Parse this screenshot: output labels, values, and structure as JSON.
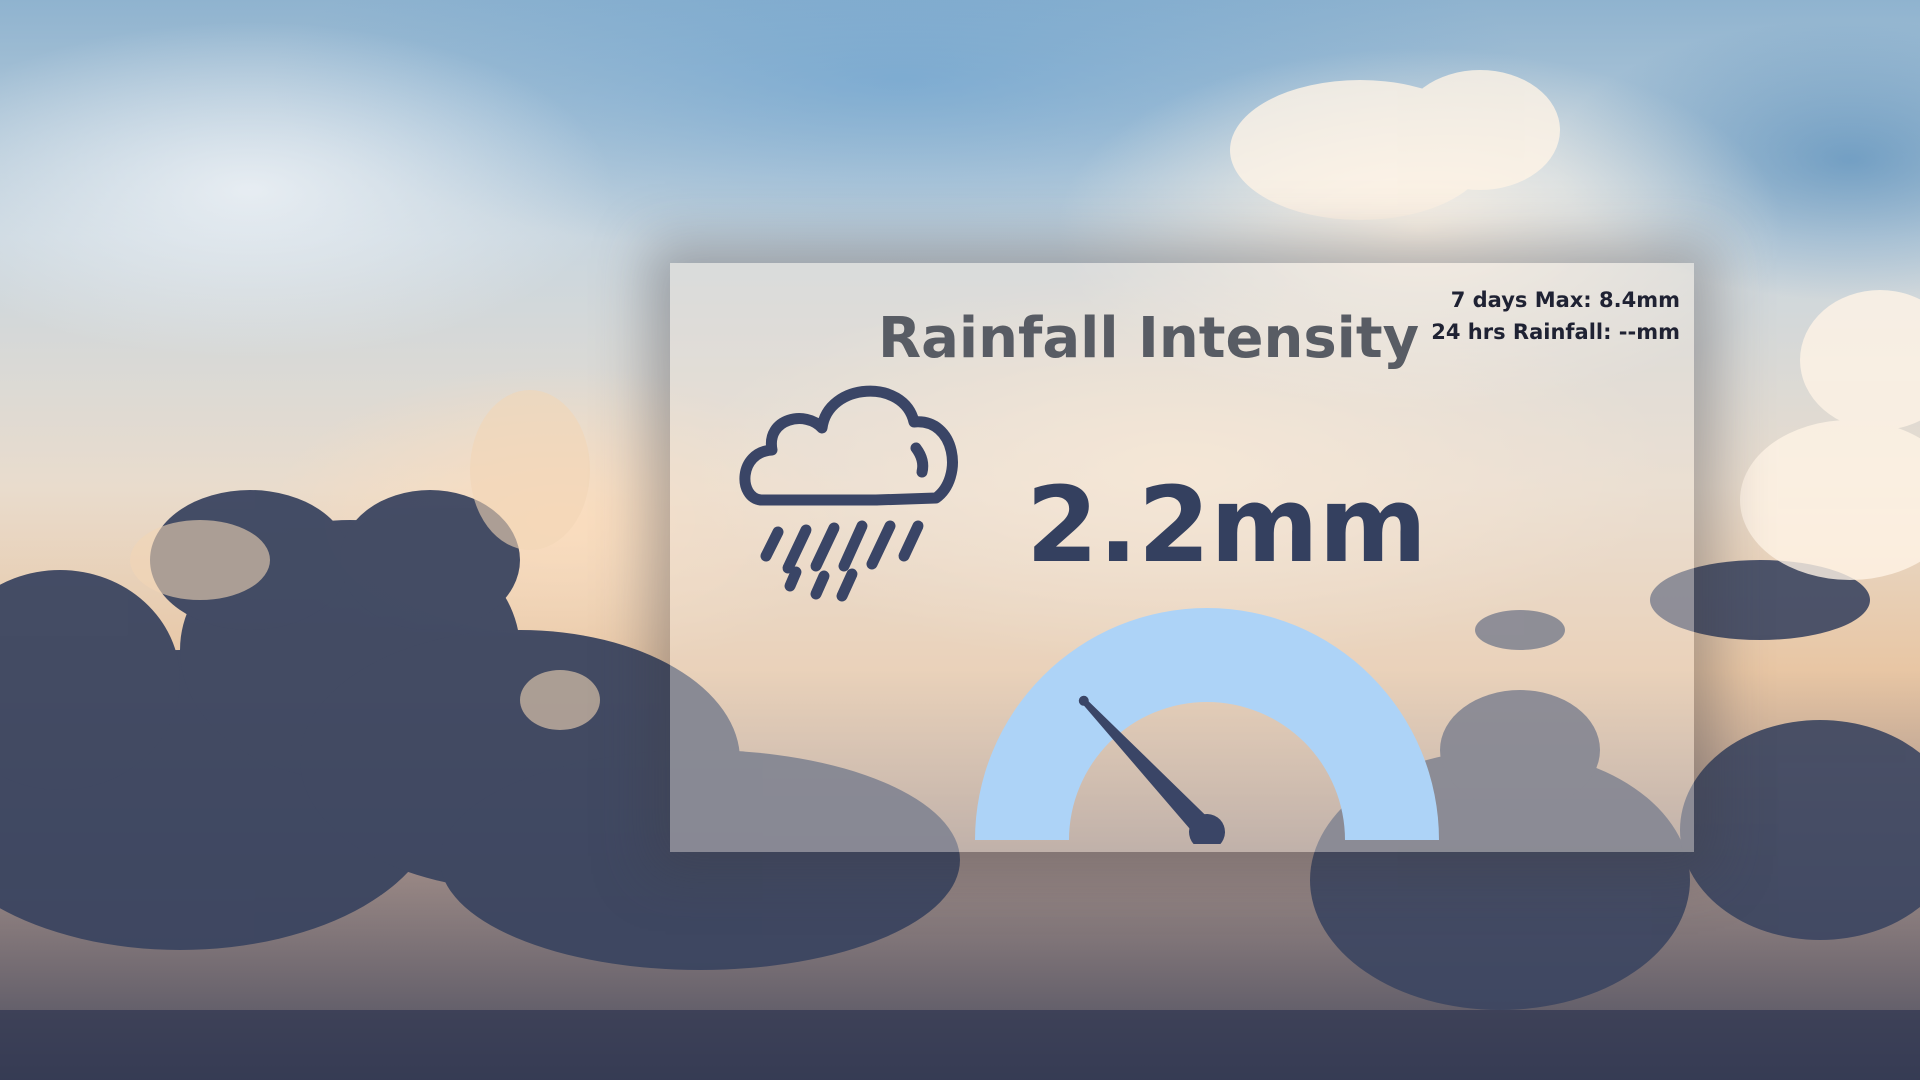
{
  "widget": {
    "title": "Rainfall Intensity",
    "current_value": "2.2mm",
    "stats": {
      "seven_day_max": "7 days Max: 8.4mm",
      "last_24h_rainfall": "24 hrs Rainfall: --mm"
    },
    "gauge_level_fraction": 0.26,
    "icon": "cloud-rain-icon"
  },
  "colors": {
    "text_dark": "#34405f",
    "title_gray": "#585c64",
    "gauge_fill": "#add3f7",
    "icon_navy": "#3a4566"
  }
}
